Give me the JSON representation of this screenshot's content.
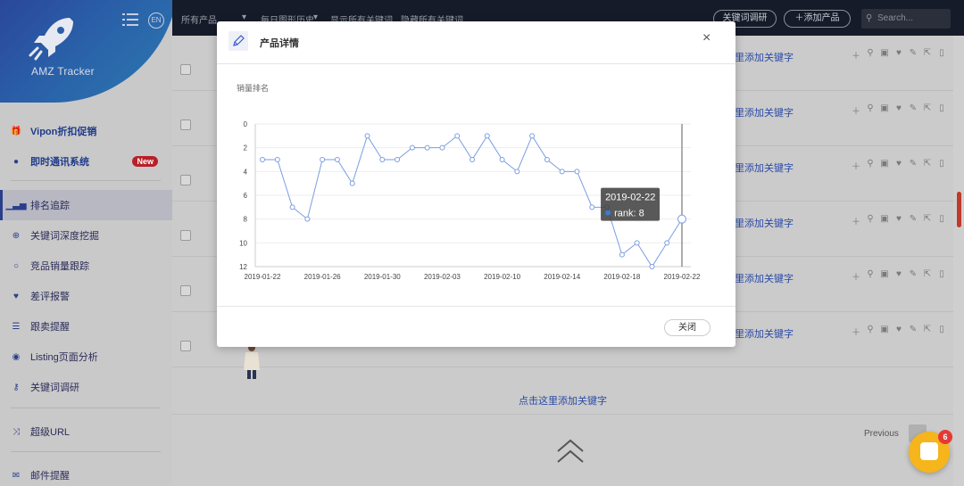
{
  "sidebar": {
    "logo_text": "AMZ Tracker",
    "lang": "EN",
    "items": [
      {
        "label": "Vipon折扣促销",
        "icon": "gift-icon"
      },
      {
        "label": "即时通讯系统",
        "icon": "chat-icon",
        "badge": "New"
      },
      {
        "label": "排名追踪",
        "icon": "bar-chart-icon"
      },
      {
        "label": "关键词深度挖掘",
        "icon": "zoom-in-icon"
      },
      {
        "label": "竞品销量跟踪",
        "icon": "search-icon"
      },
      {
        "label": "差评报警",
        "icon": "heart-icon"
      },
      {
        "label": "跟卖提醒",
        "icon": "list-icon"
      },
      {
        "label": "Listing页面分析",
        "icon": "eye-icon"
      },
      {
        "label": "关键词调研",
        "icon": "key-icon"
      },
      {
        "label": "超级URL",
        "icon": "shuffle-icon"
      },
      {
        "label": "邮件提醒",
        "icon": "mail-icon"
      }
    ]
  },
  "topbar": {
    "filter_all": "所有产品",
    "history": "每日图形历史",
    "show_kw": "显示所有关键词",
    "hide_kw": "隐藏所有关键词",
    "kw_research_btn": "关键词调研",
    "add_product_btn": "添加产品",
    "search_placeholder": "Search..."
  },
  "main": {
    "row_link": "里添加关键字",
    "add_kw_bar": "点击这里添加关键字",
    "previous": "Previous"
  },
  "modal": {
    "title": "产品详情",
    "chart_label": "销量排名",
    "close_btn": "关闭",
    "tooltip_date": "2019-02-22",
    "tooltip_value": "rank: 8"
  },
  "chat": {
    "badge": "6"
  },
  "chart_data": {
    "type": "line",
    "ylabel": "销量排名",
    "ylim": [
      0,
      12
    ],
    "y_inverted": true,
    "yticks": [
      0,
      2,
      4,
      6,
      8,
      10,
      12
    ],
    "x_tick_labels": [
      "2019-01-22",
      "2019-01-26",
      "2019-01-30",
      "2019-02-03",
      "2019-02-10",
      "2019-02-14",
      "2019-02-18",
      "2019-02-22"
    ],
    "series": [
      {
        "values": [
          3,
          3,
          7,
          8,
          3,
          3,
          5,
          1,
          3,
          3,
          2,
          2,
          2,
          1,
          3,
          1,
          3,
          4,
          1,
          3,
          4,
          4,
          7,
          7,
          11,
          10,
          12,
          10,
          8
        ]
      }
    ],
    "color": "#7b9ee0"
  }
}
